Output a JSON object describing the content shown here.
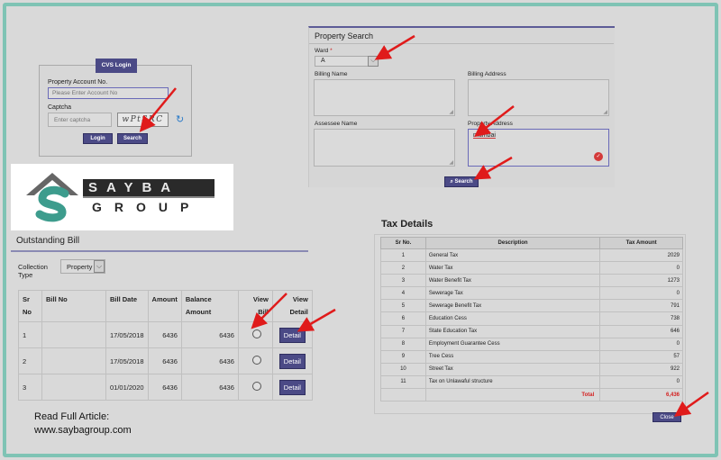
{
  "login": {
    "title": "CVS Login",
    "account_label": "Property Account No.",
    "account_placeholder": "Please Enter Account No",
    "captcha_label": "Captcha",
    "captcha_placeholder": "Enter captcha",
    "captcha_text": "wPtSRC",
    "login_button": "Login",
    "search_button": "Search"
  },
  "property_search": {
    "title": "Property Search",
    "ward_label": "Ward",
    "ward_required": "*",
    "ward_value": "A",
    "billing_name_label": "Billing Name",
    "billing_address_label": "Billing Address",
    "assessee_name_label": "Assessee Name",
    "property_address_label": "Property Address",
    "property_address_value": "mumbai",
    "search_button": "Search"
  },
  "logo": {
    "top_text": "SAYBA",
    "bottom_text": "GROUP"
  },
  "outstanding_bill": {
    "title": "Outstanding Bill",
    "collection_type_label": "Collection Type",
    "collection_type_value": "Property",
    "columns": [
      "Sr No",
      "Bill No",
      "Bill Date",
      "Amount",
      "Balance Amount",
      "View Bill",
      "View Detail"
    ],
    "detail_label": "Detail",
    "rows": [
      {
        "sr": "1",
        "bill_no": "",
        "bill_date": "17/05/2018",
        "amount": "6436",
        "balance": "6436"
      },
      {
        "sr": "2",
        "bill_no": "",
        "bill_date": "17/05/2018",
        "amount": "6436",
        "balance": "6436"
      },
      {
        "sr": "3",
        "bill_no": "",
        "bill_date": "01/01/2020",
        "amount": "6436",
        "balance": "6436"
      }
    ]
  },
  "tax_details": {
    "title": "Tax Details",
    "columns": [
      "Sr No.",
      "Description",
      "Tax Amount"
    ],
    "rows": [
      {
        "sr": "1",
        "desc": "General Tax",
        "amount": "2029"
      },
      {
        "sr": "2",
        "desc": "Water Tax",
        "amount": "0"
      },
      {
        "sr": "3",
        "desc": "Water Benefit Tax",
        "amount": "1273"
      },
      {
        "sr": "4",
        "desc": "Sewerage Tax",
        "amount": "0"
      },
      {
        "sr": "5",
        "desc": "Sewerage Benefit Tax",
        "amount": "791"
      },
      {
        "sr": "6",
        "desc": "Education Cess",
        "amount": "738"
      },
      {
        "sr": "7",
        "desc": "State Education Tax",
        "amount": "646"
      },
      {
        "sr": "8",
        "desc": "Employment Guarantee Cess",
        "amount": "0"
      },
      {
        "sr": "9",
        "desc": "Tree Cess",
        "amount": "57"
      },
      {
        "sr": "10",
        "desc": "Street Tax",
        "amount": "922"
      },
      {
        "sr": "11",
        "desc": "Tax on Unlawaful structure",
        "amount": "0"
      }
    ],
    "total_label": "Total",
    "total_value": "6,436",
    "close_button": "Close"
  },
  "footer": {
    "line1": "Read Full Article:",
    "line2": "www.saybagroup.com"
  },
  "colors": {
    "accent": "#4b4a86",
    "frame": "#7fc3b4",
    "arrow": "#e01b1b",
    "total": "#d42020"
  }
}
